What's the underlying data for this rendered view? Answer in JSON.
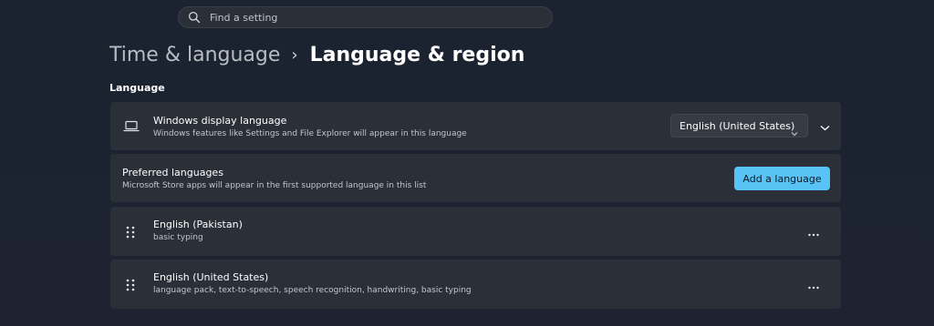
{
  "search": {
    "placeholder": "Find a setting",
    "icon": "search-icon"
  },
  "breadcrumb": {
    "parent": "Time & language",
    "separator": "›",
    "current": "Language & region"
  },
  "section": {
    "title": "Language"
  },
  "display_language": {
    "icon": "laptop-icon",
    "title": "Windows display language",
    "description": "Windows features like Settings and File Explorer will appear in this language",
    "selected": "English (United States)"
  },
  "preferred_languages": {
    "title": "Preferred languages",
    "description": "Microsoft Store apps will appear in the first supported language in this list",
    "add_button": "Add a language"
  },
  "languages": [
    {
      "name": "English (Pakistan)",
      "features": "basic typing"
    },
    {
      "name": "English (United States)",
      "features": "language pack, text-to-speech, speech recognition, handwriting, basic typing"
    }
  ],
  "colors": {
    "background": "#1c2330",
    "card": "#2a2f38",
    "accent": "#58c4f6"
  }
}
